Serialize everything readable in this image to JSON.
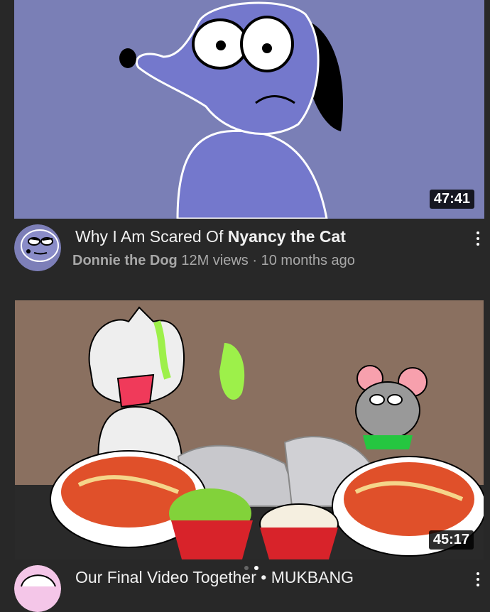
{
  "videos": [
    {
      "title_prefix": "Why I Am Scared Of ",
      "title_highlight": "Nyancy the Cat",
      "channel": "Donnie the Dog",
      "views": "12M views",
      "separator": "·",
      "age": "10 months ago",
      "duration": "47:41",
      "thumbnail_icon": "blue-dog-cartoon-thumbnail",
      "avatar_icon": "donnie-dog-avatar"
    },
    {
      "title": "Our Final Video Together • MUKBANG",
      "duration": "45:17",
      "thumbnail_icon": "cat-mouse-mukbang-thumbnail",
      "avatar_icon": "pink-character-avatar"
    }
  ],
  "colors": {
    "background": "#282828",
    "thumb1_bg": "#7a7fb6",
    "thumb2_bg": "#8a7060"
  }
}
